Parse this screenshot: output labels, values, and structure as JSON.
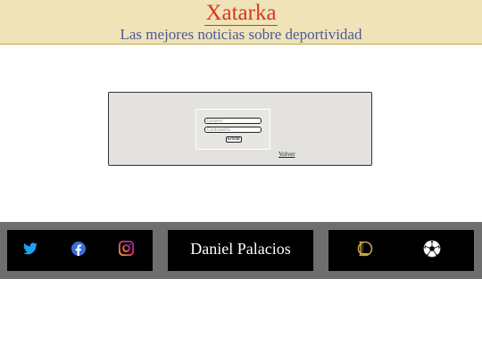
{
  "header": {
    "title": "Xatarka",
    "subtitle": "Las mejores noticias sobre deportividad"
  },
  "login": {
    "username_placeholder": "Usuario",
    "password_placeholder": "Contraseña",
    "submit_label": "Enviar",
    "back_label": "Volver"
  },
  "footer": {
    "author": "Daniel Palacios",
    "social_icons": [
      "twitter-icon",
      "facebook-icon",
      "instagram-icon"
    ],
    "link_icons": [
      "league-of-legends-icon",
      "soccer-ball-icon"
    ]
  },
  "colors": {
    "header_bg": "#f0e3b8",
    "title": "#d23a1f",
    "subtitle": "#4a5a9a",
    "footer_bg": "#6e6e6e",
    "footer_box": "#000000",
    "panel_bg": "#e3e2de"
  }
}
